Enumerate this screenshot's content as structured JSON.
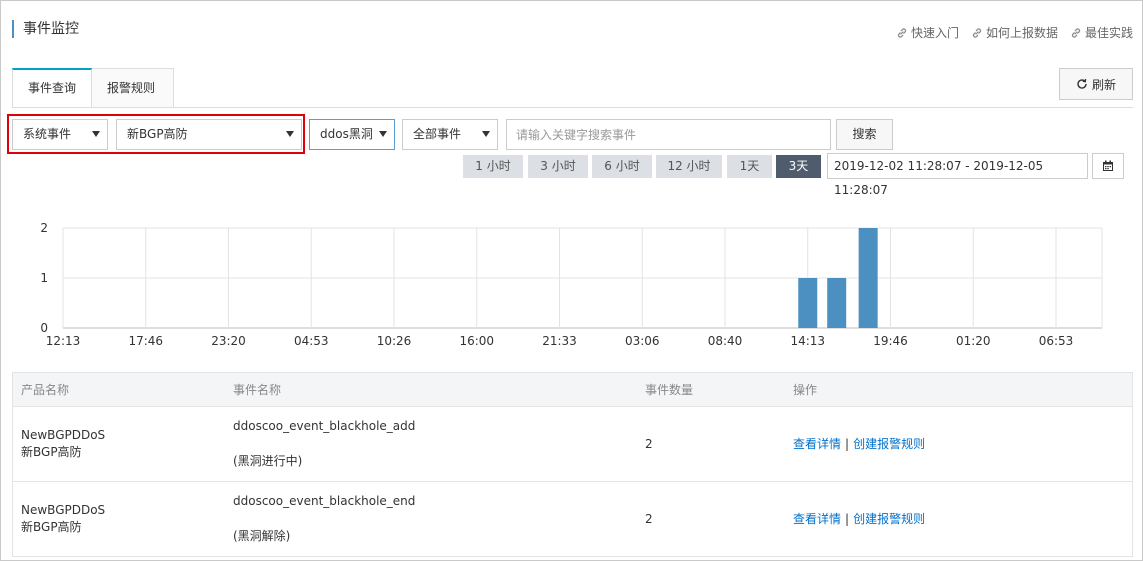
{
  "header": {
    "title": "事件监控",
    "links": [
      "快速入门",
      "如何上报数据",
      "最佳实践"
    ]
  },
  "tabs": [
    {
      "label": "事件查询",
      "active": true
    },
    {
      "label": "报警规则",
      "active": false
    }
  ],
  "toolbar": {
    "refresh_label": "刷新",
    "event_type": "系统事件",
    "product": "新BGP高防",
    "event_name": "ddos黑洞",
    "level": "全部事件",
    "search_placeholder": "请输入关键字搜索事件",
    "search_label": "搜索"
  },
  "time_range": {
    "options": [
      "1 小时",
      "3 小时",
      "6 小时",
      "12 小时",
      "1天",
      "3天"
    ],
    "selected": "3天",
    "range_text": "2019-12-02 11:28:07 - 2019-12-05 11:28:07"
  },
  "chart_data": {
    "type": "bar",
    "categories": [
      "12:13",
      "17:46",
      "23:20",
      "04:53",
      "10:26",
      "16:00",
      "21:33",
      "03:06",
      "08:40",
      "14:13",
      "19:46",
      "01:20",
      "06:53"
    ],
    "ylim": [
      0,
      2
    ],
    "yticks": [
      0,
      1,
      2
    ],
    "bars": [
      {
        "x": 9.0,
        "value": 1
      },
      {
        "x": 9.35,
        "value": 1
      },
      {
        "x": 9.73,
        "value": 2
      }
    ],
    "bar_color": "#4c8fc1",
    "grid": true
  },
  "table": {
    "columns": [
      "产品名称",
      "事件名称",
      "事件数量",
      "操作"
    ],
    "rows": [
      {
        "product_en": "NewBGPDDoS",
        "product_cn": "新BGP高防",
        "event": "ddoscoo_event_blackhole_add",
        "event_desc": "(黑洞进行中)",
        "count": "2",
        "op_detail": "查看详情",
        "op_rule": "创建报警规则"
      },
      {
        "product_en": "NewBGPDDoS",
        "product_cn": "新BGP高防",
        "event": "ddoscoo_event_blackhole_end",
        "event_desc": "(黑洞解除)",
        "count": "2",
        "op_detail": "查看详情",
        "op_rule": "创建报警规则"
      }
    ]
  }
}
